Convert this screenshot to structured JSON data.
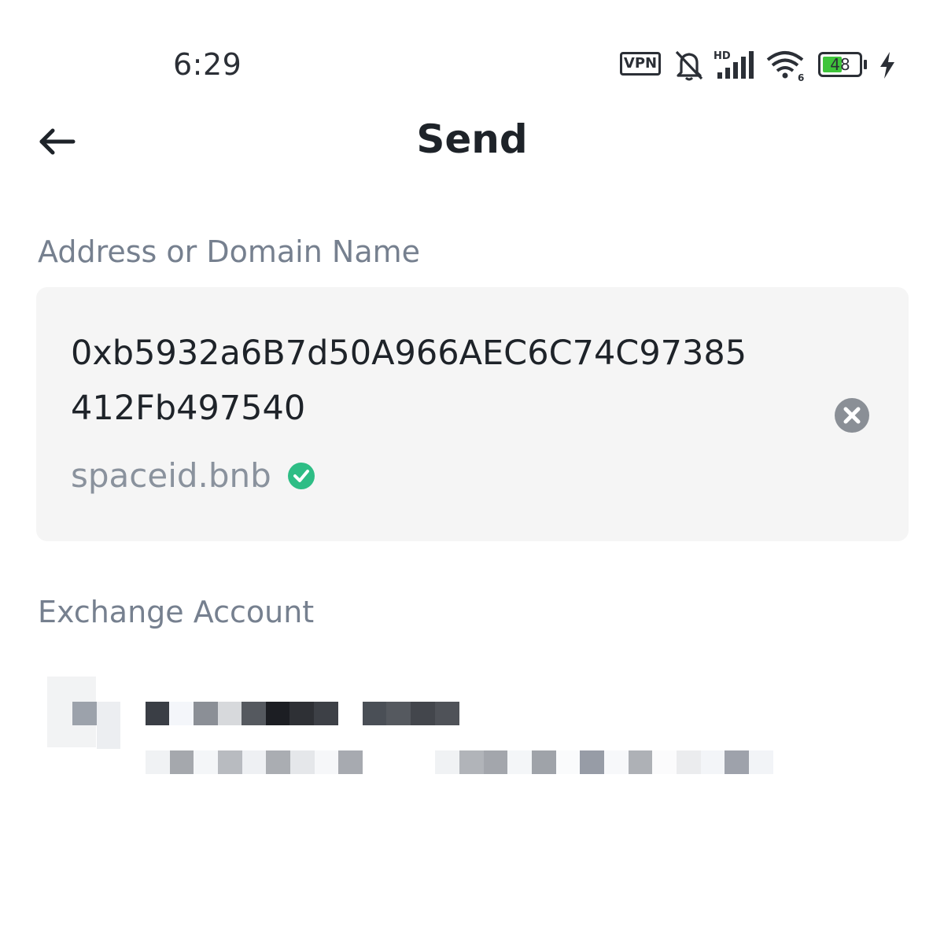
{
  "status_bar": {
    "time": "6:29",
    "vpn": "VPN",
    "network_tag": "HD",
    "wifi_tag": "6",
    "battery_level": "48",
    "battery_percent": 48
  },
  "header": {
    "title": "Send"
  },
  "address_section": {
    "label": "Address or Domain Name",
    "address_line1": "0xb5932a6B7d50A966AEC6C74C97385",
    "address_line2": "412Fb497540",
    "domain": "spaceid.bnb"
  },
  "exchange_section": {
    "label": "Exchange Account"
  },
  "colors": {
    "accent_green": "#2ebd85",
    "label_gray": "#76808f",
    "input_bg": "#f5f5f5"
  },
  "icons": {
    "back": "arrow-left-icon",
    "clear": "close-circle-icon",
    "verified": "check-circle-icon",
    "mute": "bell-off-icon",
    "signal": "signal-icon",
    "wifi": "wifi-icon",
    "charging": "bolt-icon"
  }
}
